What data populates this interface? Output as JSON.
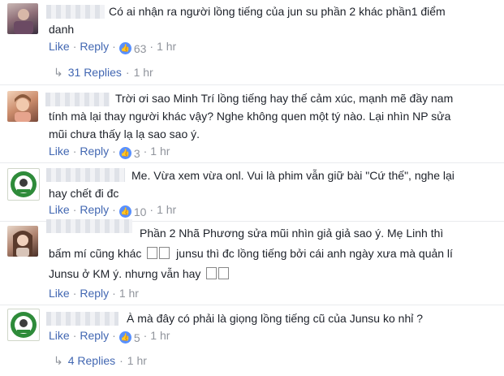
{
  "comments": [
    {
      "lines": [
        "Có ai nhận ra người lồng tiếng của jun su phần 2 khác phần1 điểm",
        "danh"
      ],
      "like": "Like",
      "reply": "Reply",
      "likes": "63",
      "time": "1 hr",
      "replies": "31 Replies",
      "replies_time": "1 hr"
    },
    {
      "lines": [
        "Trời ơi sao Minh Trí lồng tiếng hay thế cảm xúc, mạnh mẽ đầy nam",
        "tính mà lại thay người khác vậy? Nghe không quen một tý nào. Lại nhìn NP sửa",
        "mũi chưa thấy lạ lạ sao sao ý."
      ],
      "like": "Like",
      "reply": "Reply",
      "likes": "3",
      "time": "1 hr"
    },
    {
      "lines": [
        "Me. Vừa xem vừa onl. Vui là phim vẫn giữ bài \"Cứ thế\", nghe lại",
        "hay chết đi đc"
      ],
      "like": "Like",
      "reply": "Reply",
      "likes": "10",
      "time": "1 hr"
    },
    {
      "lines": [
        "Phần 2 Nhã Phương sửa mũi nhìn giả giả sao ý. Mẹ Linh thì",
        "bấm mí cũng khác",
        "junsu thì đc lồng tiếng bởi cái anh ngày xưa mà quản lí",
        "Junsu ở KM ý. nhưng vẫn hay"
      ],
      "like": "Like",
      "reply": "Reply",
      "time": "1 hr"
    },
    {
      "lines": [
        "À mà đây có phải là giọng lồng tiếng cũ của Junsu ko nhỉ ?"
      ],
      "like": "Like",
      "reply": "Reply",
      "likes": "5",
      "time": "1 hr",
      "replies": "4 Replies",
      "replies_time": "1 hr"
    }
  ],
  "colors": {
    "link": "#4267b2",
    "meta": "#90949c",
    "text": "#1d2129",
    "like_badge": "#5890ff"
  },
  "icons": {
    "like_badge": "thumbs-up-icon",
    "reply_arrow": "reply-arrow-icon"
  }
}
